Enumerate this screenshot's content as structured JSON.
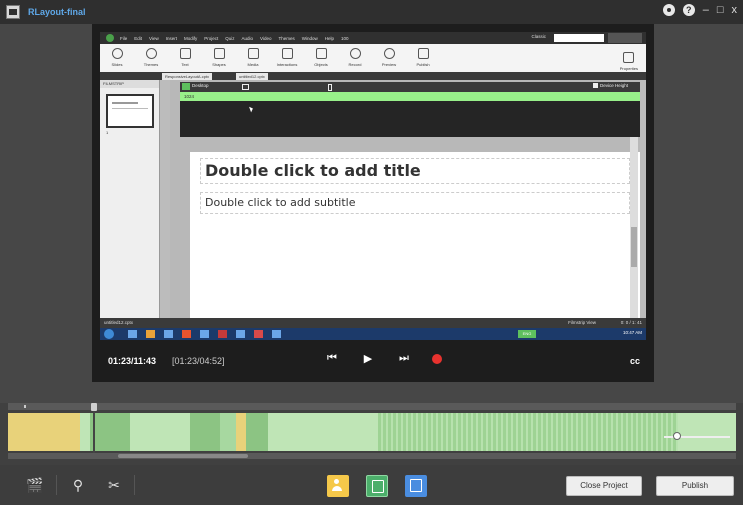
{
  "app": {
    "title": "RLayout-final",
    "colors": {
      "accent_title": "#5fa8e8",
      "record": "#e8322e",
      "track_green": "#a7d8a0",
      "track_yellow": "#e8d27a"
    }
  },
  "titlebar": {
    "icons": [
      "settings-gear-icon",
      "help-icon"
    ],
    "minimize": "–",
    "maximize": "□",
    "close": "x"
  },
  "video": {
    "menubar": {
      "items": [
        "File",
        "Edit",
        "View",
        "Insert",
        "Modify",
        "Project",
        "Quiz",
        "Audio",
        "Video",
        "Themes",
        "Window",
        "Help"
      ],
      "zoom": "100",
      "workspace": "Classic"
    },
    "ribbon": {
      "items": [
        "Slides",
        "Themes",
        "Text",
        "Shapes",
        "Media",
        "Interactions",
        "Objects",
        "Record",
        "Preview",
        "Publish"
      ],
      "right_item": "Properties"
    },
    "tabs": [
      "ResponsiveLayoutA.cptx",
      "untitled12.cptx"
    ],
    "filmstrip": {
      "header": "FILMSTRIP",
      "slide_number": "1"
    },
    "canvas": {
      "device_label": "Desktop",
      "device_height_label": "Device Height",
      "breakpoint_value": "1024",
      "slide_title_placeholder": "Double click to add title",
      "slide_subtitle_placeholder": "Double click to add subtitle"
    },
    "statusbar": {
      "file": "untitled12.cptx",
      "view": "Filmstrip View",
      "dimensions": "0: 0 / 1: 41"
    },
    "taskbar": {
      "clock": "10:47 AM",
      "tray_badge": "ENG"
    }
  },
  "playback": {
    "current_time": "01:23/11:43",
    "segment_time": "[01:23/04:52]",
    "buttons": [
      "skip-back-icon",
      "play-icon",
      "skip-forward-icon",
      "record-icon"
    ],
    "cc_label": "cc"
  },
  "timeline": {
    "playhead_fraction": 0.118,
    "zoom_fraction": 0.2
  },
  "bottombar": {
    "tools": [
      "clapperboard-icon",
      "marker-tool-icon",
      "scissors-icon"
    ],
    "modes": [
      "actor-mode-icon",
      "slide-mode-icon",
      "layout-mode-icon"
    ],
    "close_project_label": "Close Project",
    "publish_label": "Publish"
  }
}
